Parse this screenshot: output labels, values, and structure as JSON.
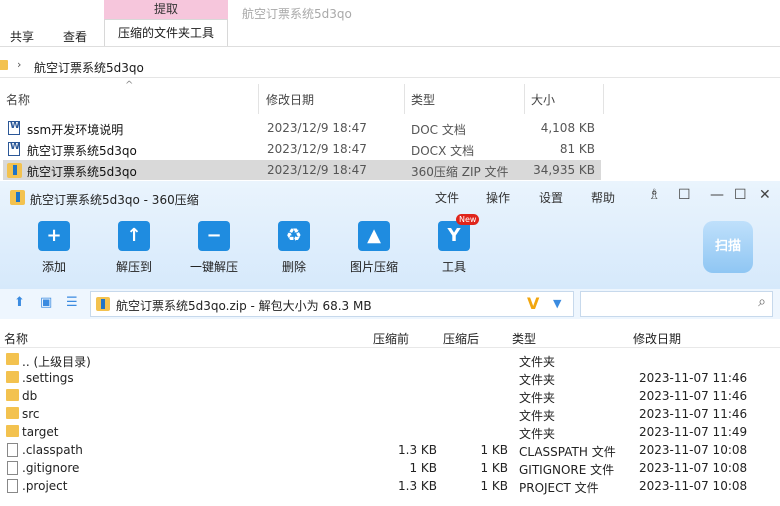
{
  "explorer": {
    "ribbon": {
      "share": "共享",
      "view": "查看",
      "context_group": "提取",
      "context_tab": "压缩的文件夹工具",
      "window_title": "航空订票系统5d3qo"
    },
    "address": {
      "crumb": "航空订票系统5d3qo"
    },
    "columns": {
      "name": "名称",
      "date": "修改日期",
      "type": "类型",
      "size": "大小"
    },
    "files": [
      {
        "name": "ssm开发环境说明",
        "date": "2023/12/9 18:47",
        "type": "DOC 文档",
        "size": "4,108 KB",
        "icon": "word-doc-icon"
      },
      {
        "name": "航空订票系统5d3qo",
        "date": "2023/12/9 18:47",
        "type": "DOCX 文档",
        "size": "81 KB",
        "icon": "word-doc-icon"
      },
      {
        "name": "航空订票系统5d3qo",
        "date": "2023/12/9 18:47",
        "type": "360压缩 ZIP 文件",
        "size": "34,935 KB",
        "icon": "zip-icon"
      }
    ]
  },
  "zipapp": {
    "title": "航空订票系统5d3qo - 360压缩",
    "menu": {
      "file": "文件",
      "ops": "操作",
      "settings": "设置",
      "help": "帮助"
    },
    "tools": [
      {
        "label": "添加",
        "icon": "add-icon"
      },
      {
        "label": "解压到",
        "icon": "extract-to-icon"
      },
      {
        "label": "一键解压",
        "icon": "one-click-extract-icon"
      },
      {
        "label": "删除",
        "icon": "delete-icon"
      },
      {
        "label": "图片压缩",
        "icon": "image-compress-icon"
      },
      {
        "label": "工具",
        "icon": "tools-icon"
      }
    ],
    "new_badge": "New",
    "scan": "扫描",
    "path": "航空订票系统5d3qo.zip - 解包大小为 68.3 MB",
    "columns": {
      "name": "名称",
      "compressed": "压缩前",
      "packed": "压缩后",
      "type": "类型",
      "date": "修改日期"
    },
    "rows": [
      {
        "name": ".. (上级目录)",
        "compressed": "",
        "packed": "",
        "type": "文件夹",
        "date": "",
        "kind": "folder"
      },
      {
        "name": ".settings",
        "compressed": "",
        "packed": "",
        "type": "文件夹",
        "date": "2023-11-07 11:46",
        "kind": "folder"
      },
      {
        "name": "db",
        "compressed": "",
        "packed": "",
        "type": "文件夹",
        "date": "2023-11-07 11:46",
        "kind": "folder"
      },
      {
        "name": "src",
        "compressed": "",
        "packed": "",
        "type": "文件夹",
        "date": "2023-11-07 11:46",
        "kind": "folder"
      },
      {
        "name": "target",
        "compressed": "",
        "packed": "",
        "type": "文件夹",
        "date": "2023-11-07 11:49",
        "kind": "folder"
      },
      {
        "name": ".classpath",
        "compressed": "1.3 KB",
        "packed": "1 KB",
        "type": "CLASSPATH 文件",
        "date": "2023-11-07 10:08",
        "kind": "file"
      },
      {
        "name": ".gitignore",
        "compressed": "1 KB",
        "packed": "1 KB",
        "type": "GITIGNORE 文件",
        "date": "2023-11-07 10:08",
        "kind": "file"
      },
      {
        "name": ".project",
        "compressed": "1.3 KB",
        "packed": "1 KB",
        "type": "PROJECT 文件",
        "date": "2023-11-07 10:08",
        "kind": "file"
      }
    ]
  }
}
